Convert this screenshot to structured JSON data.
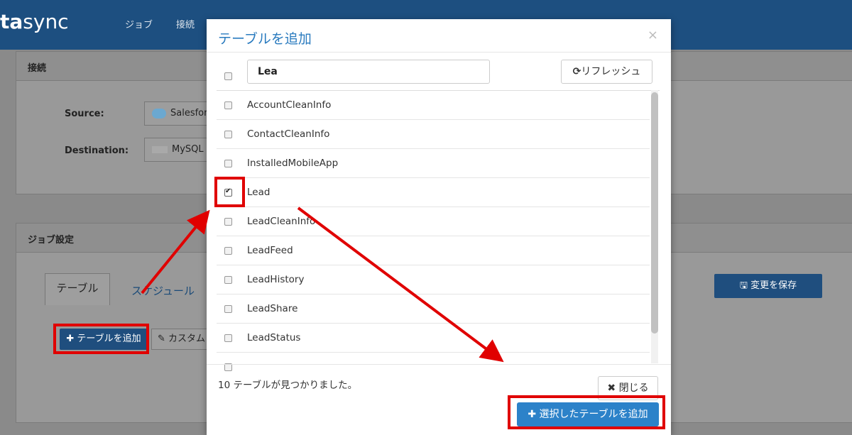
{
  "app": {
    "logo_prefix": "ta",
    "logo_name": "sync",
    "nav": [
      "ジョブ",
      "接続"
    ]
  },
  "connection_panel": {
    "title": "接続",
    "source_label": "Source:",
    "source_value": "Salesfor",
    "destination_label": "Destination:",
    "destination_value": "MySQL"
  },
  "job_panel": {
    "title": "ジョブ設定",
    "tabs": [
      "テーブル",
      "スケジュール"
    ],
    "add_table_label": "✚ テーブルを追加",
    "custom_label": "カスタム",
    "save_label": "変更を保存"
  },
  "modal": {
    "title": "テーブルを追加",
    "close_glyph": "×",
    "search_value": "Lea",
    "refresh_label": "リフレッシュ",
    "tables": [
      {
        "name": "AccountCleanInfo",
        "checked": false
      },
      {
        "name": "ContactCleanInfo",
        "checked": false
      },
      {
        "name": "InstalledMobileApp",
        "checked": false
      },
      {
        "name": "Lead",
        "checked": true
      },
      {
        "name": "LeadCleanInfo",
        "checked": false
      },
      {
        "name": "LeadFeed",
        "checked": false
      },
      {
        "name": "LeadHistory",
        "checked": false
      },
      {
        "name": "LeadShare",
        "checked": false
      },
      {
        "name": "LeadStatus",
        "checked": false
      }
    ],
    "status_text": "10 テーブルが見つかりました。",
    "close_label": "閉じる",
    "add_selected_label": "選択したテーブルを追加"
  },
  "colors": {
    "header": "#1d4f80",
    "primary": "#2c82c9",
    "title": "#2a7bbf",
    "highlight": "#e00000"
  }
}
